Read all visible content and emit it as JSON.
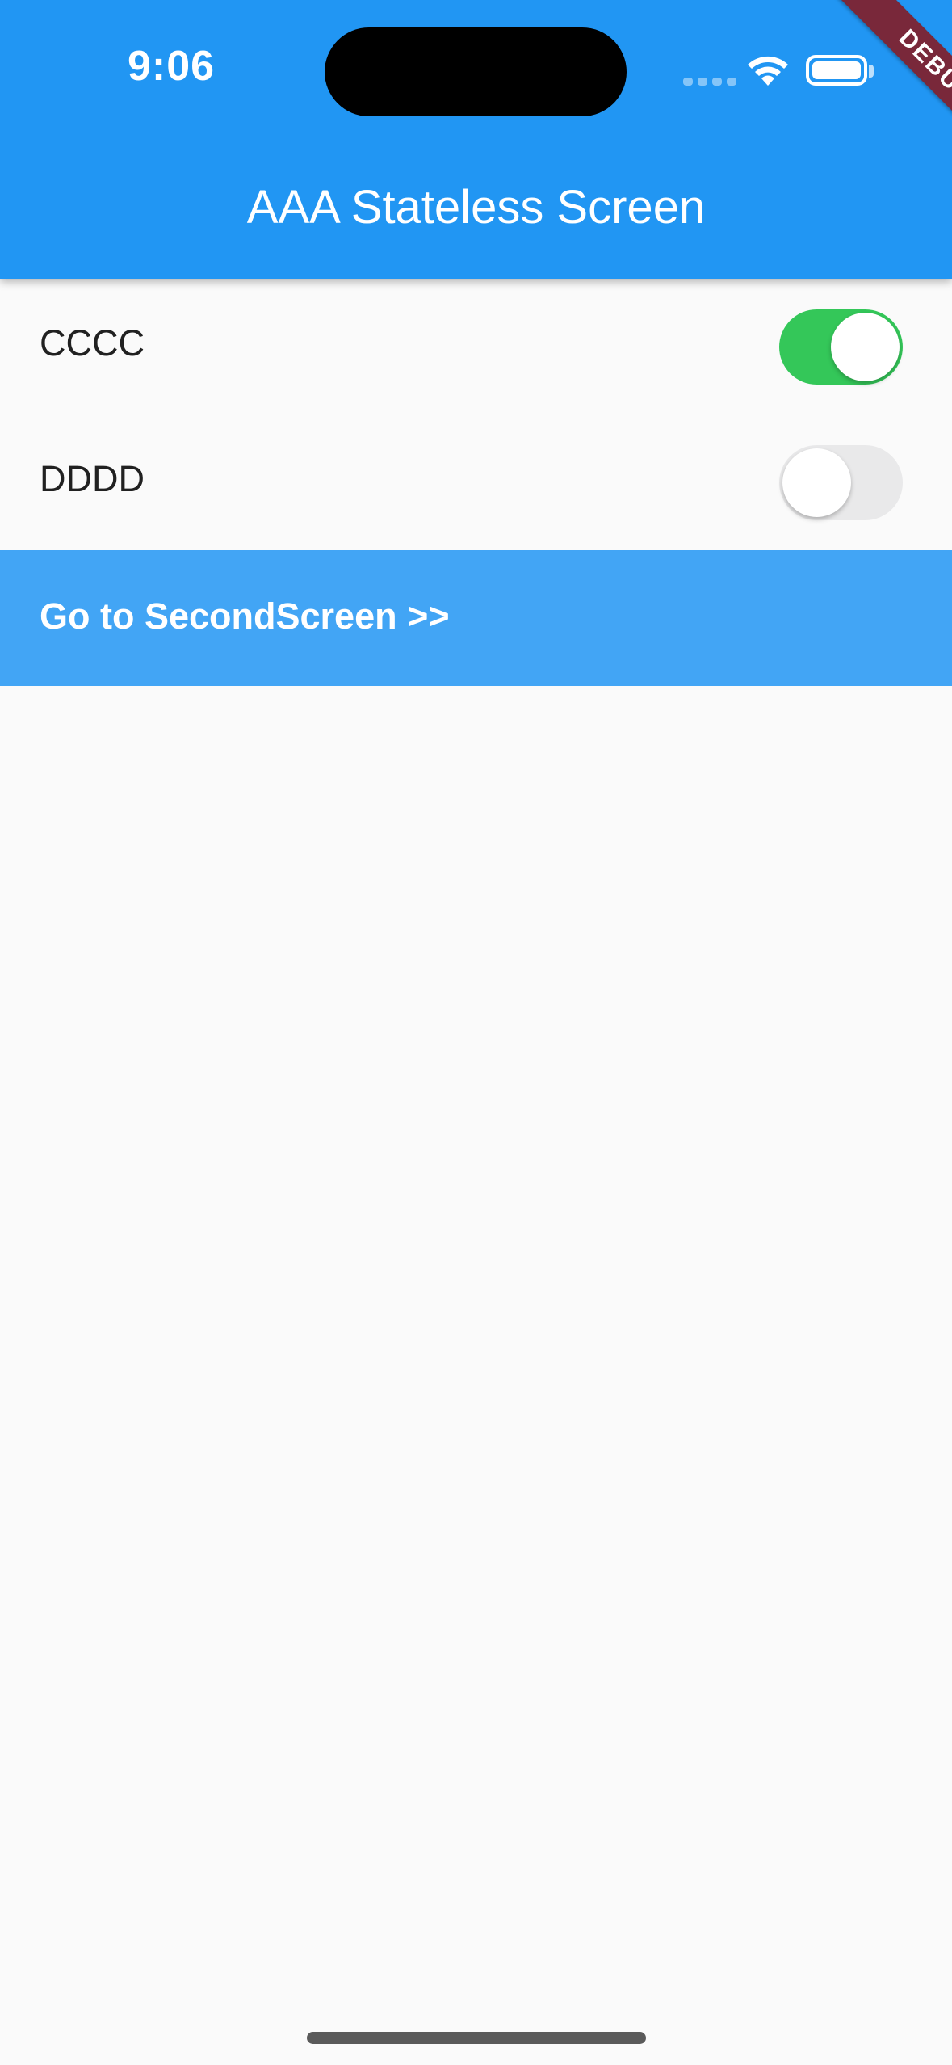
{
  "status_bar": {
    "time": "9:06",
    "wifi_icon": "wifi-icon",
    "battery_icon": "battery-icon"
  },
  "debug_banner": {
    "label": "DEBUG",
    "color": "#79283a"
  },
  "app_bar": {
    "title": "AAA Stateless Screen",
    "color": "#2196f3"
  },
  "settings": [
    {
      "label": "CCCC",
      "enabled": true
    },
    {
      "label": "DDDD",
      "enabled": false
    }
  ],
  "nav_button": {
    "label": "Go to SecondScreen >>",
    "color": "#42a5f5"
  },
  "colors": {
    "switch_on": "#34c759",
    "switch_off": "#e9e9ea",
    "background": "#fafafa"
  }
}
